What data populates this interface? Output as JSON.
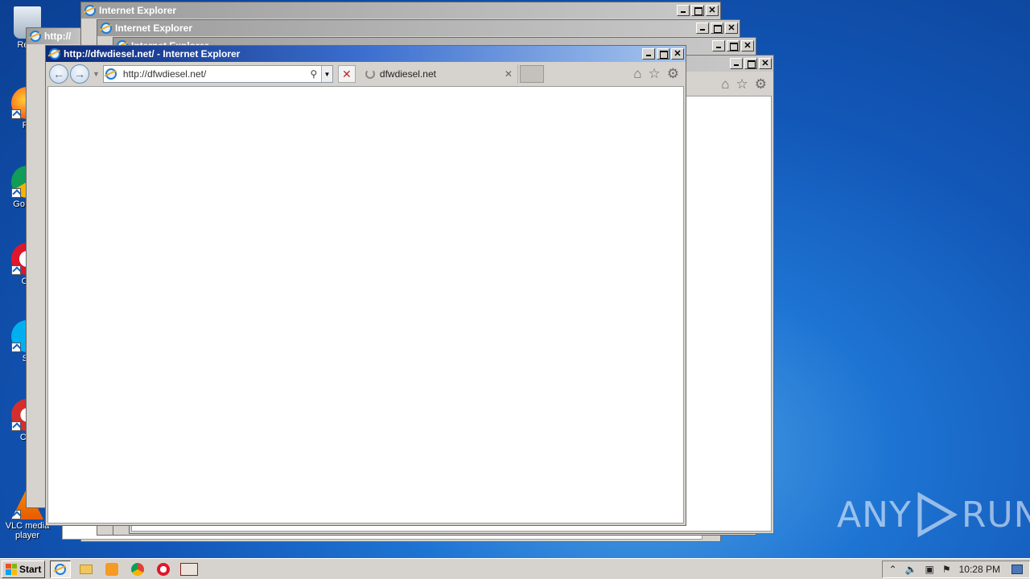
{
  "desktop": {
    "icons": [
      {
        "label": "Recy"
      },
      {
        "label": "Fir"
      },
      {
        "label": "Go Chr"
      },
      {
        "label": "Op"
      },
      {
        "label": "Sk"
      },
      {
        "label": "CCl"
      },
      {
        "label": "VLC media player"
      }
    ],
    "watermark": {
      "left": "ANY",
      "right": "RUN"
    }
  },
  "windows": {
    "bg1": {
      "title": "Internet Explorer"
    },
    "bg2": {
      "title": "Internet Explorer"
    },
    "bg3": {
      "title": "Internet Explorer"
    },
    "bg_left": {
      "title": "http://"
    },
    "active": {
      "title": "http://dfwdiesel.net/ - Internet Explorer",
      "address": "http://dfwdiesel.net/",
      "tab_label": "dfwdiesel.net"
    }
  },
  "taskbar": {
    "start_label": "Start",
    "clock": "10:28 PM"
  },
  "colors": {
    "titlebar_active": "#0b2a7a",
    "desktop": "#1257b8",
    "stop": "#c0282b"
  }
}
